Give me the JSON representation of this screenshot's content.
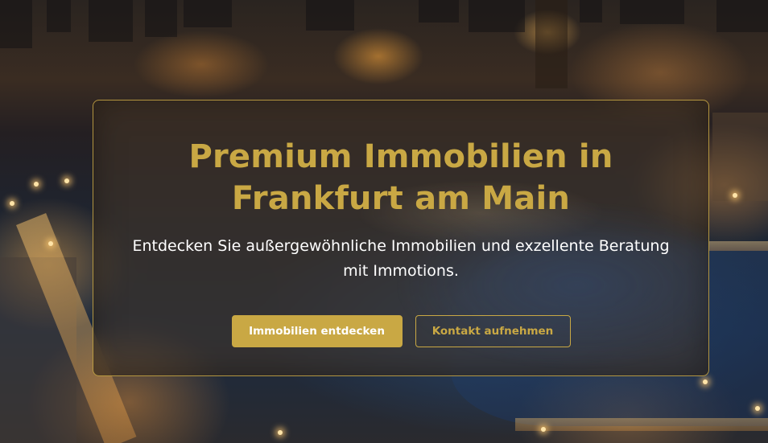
{
  "hero": {
    "title": "Premium Immobilien in Frankfurt am Main",
    "subtitle": "Entdecken Sie außergewöhnliche Immobilien und exzellente Beratung mit Immotions.",
    "primary_button": "Immobilien entdecken",
    "secondary_button": "Kontakt aufnehmen"
  },
  "colors": {
    "accent": "#c9a844",
    "text_light": "#ffffff"
  }
}
